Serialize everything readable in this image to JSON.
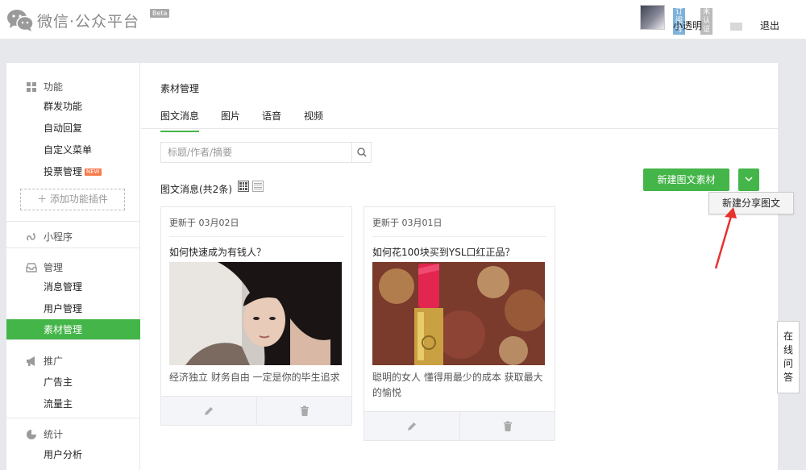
{
  "header": {
    "logo_text": "微信·公众平台",
    "beta": "Beta",
    "account_type": "订阅号",
    "account_cert": "未认证",
    "username": "小透明",
    "logout": "退出"
  },
  "sidebar": {
    "groups": [
      {
        "title": "功能",
        "icon": "grid-icon",
        "items": [
          "群发功能",
          "自动回复",
          "自定义菜单",
          "投票管理"
        ],
        "new_badge": "NEW"
      },
      {
        "title": "小程序",
        "icon": "mini-program-icon"
      },
      {
        "title": "管理",
        "icon": "inbox-icon",
        "items": [
          "消息管理",
          "用户管理",
          "素材管理"
        ]
      },
      {
        "title": "推广",
        "icon": "megaphone-icon",
        "items": [
          "广告主",
          "流量主"
        ]
      },
      {
        "title": "统计",
        "icon": "pie-chart-icon",
        "items": [
          "用户分析"
        ]
      }
    ],
    "add_plugin": "添加功能插件",
    "active_item": "素材管理"
  },
  "main": {
    "page_title": "素材管理",
    "tabs": [
      "图文消息",
      "图片",
      "语音",
      "视频"
    ],
    "active_tab": "图文消息",
    "search_placeholder": "标题/作者/摘要",
    "count_label": "图文消息(共2条)",
    "new_button": "新建图文素材",
    "dropdown_option": "新建分享图文",
    "cards": [
      {
        "date": "更新于 03月02日",
        "title": "如何快速成为有钱人？",
        "desc": "经济独立 财务自由 一定是你的毕生追求"
      },
      {
        "date": "更新于 03月01日",
        "title": "如何花100块买到YSL口红正品？",
        "desc": "聪明的女人 懂得用最少的成本 获取最大的愉悦"
      }
    ]
  },
  "float_qa": "在线问答",
  "colors": {
    "accent": "#44b549",
    "arrow": "#e8322f",
    "background": "#e7e8eb"
  }
}
